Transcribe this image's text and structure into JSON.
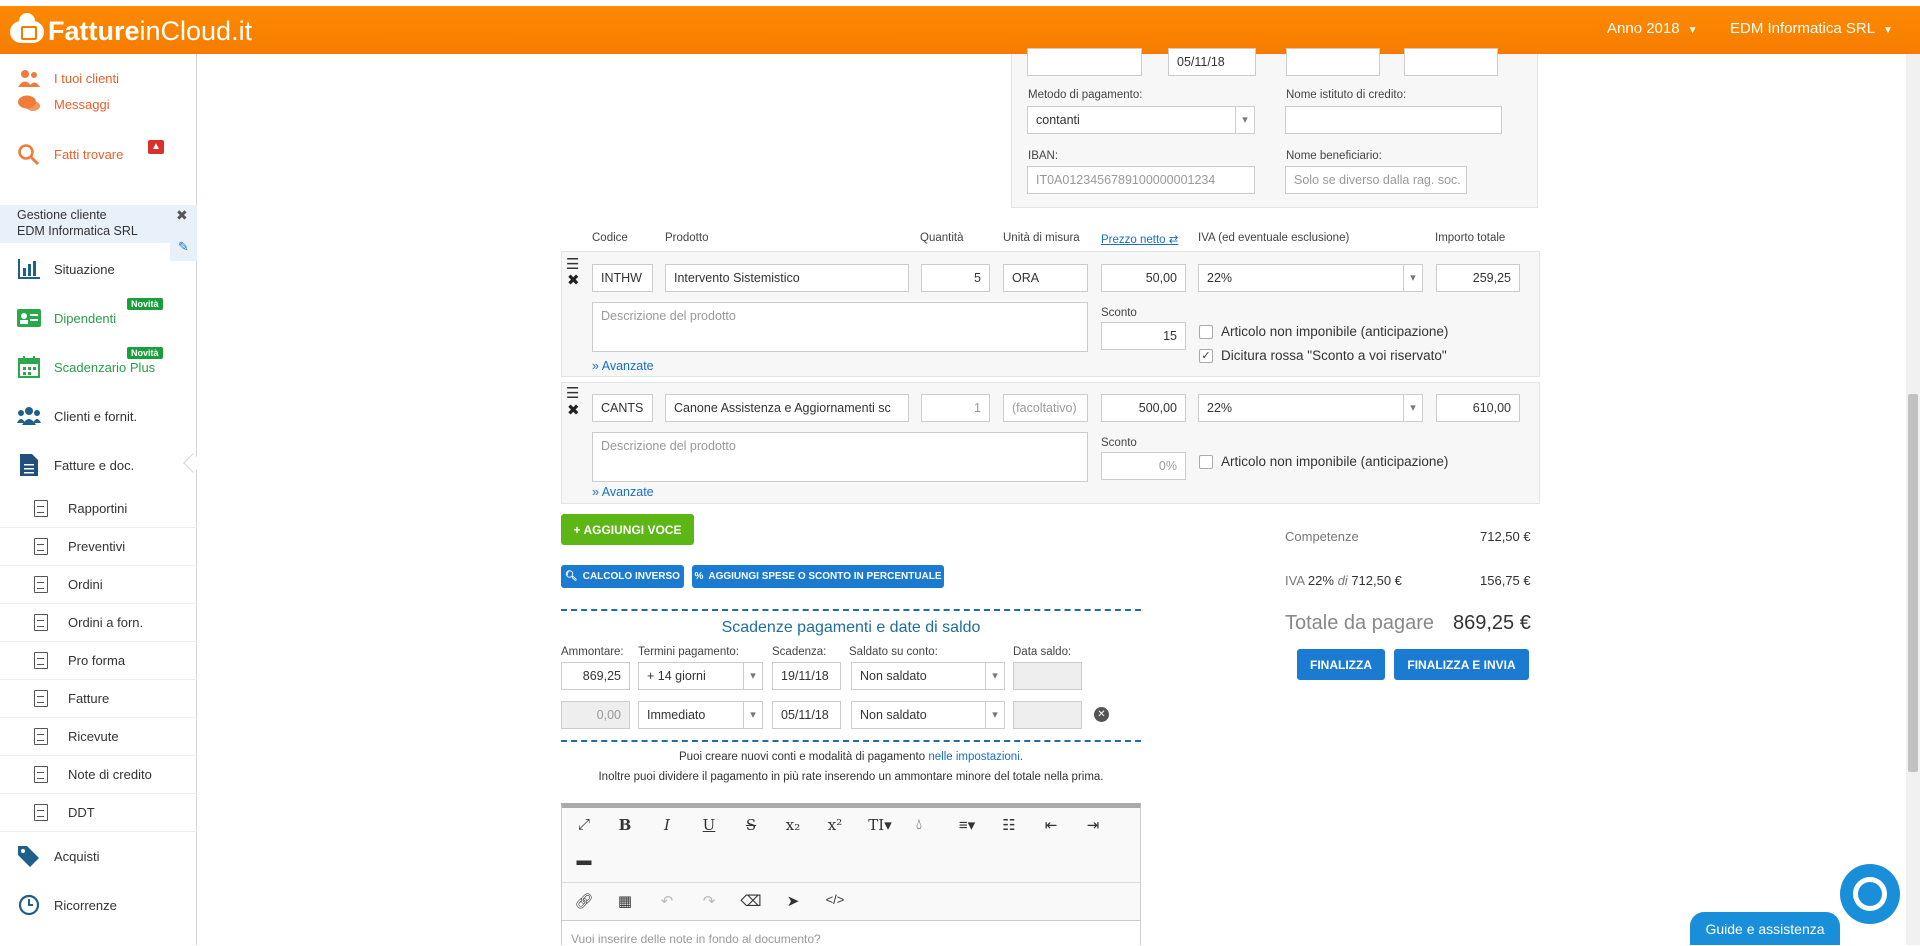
{
  "app": {
    "logo_bold": "Fatture",
    "logo_thin": "inCloud.it",
    "year_menu": "Anno 2018",
    "company_menu": "EDM Informatica SRL"
  },
  "sidebar": {
    "top_items": [
      {
        "label": "I tuoi clienti"
      },
      {
        "label": "Messaggi"
      },
      {
        "label": "Fatti trovare"
      }
    ],
    "gestione_title": "Gestione cliente",
    "gestione_client": "EDM Informatica SRL",
    "items": [
      {
        "label": "Situazione"
      },
      {
        "label": "Dipendenti",
        "badge": "Novità"
      },
      {
        "label": "Scadenzario Plus",
        "badge": "Novità"
      },
      {
        "label": "Clienti e fornit."
      },
      {
        "label": "Fatture e doc."
      }
    ],
    "sub_items": [
      "Rapportini",
      "Preventivi",
      "Ordini",
      "Ordini a forn.",
      "Pro forma",
      "Fatture",
      "Ricevute",
      "Note di credito",
      "DDT"
    ],
    "bottom_items": [
      {
        "label": "Acquisti"
      },
      {
        "label": "Ricorrenze"
      }
    ]
  },
  "payment": {
    "date_value": "05/11/18",
    "method_label": "Metodo di pagamento:",
    "method_value": "contanti",
    "bank_label": "Nome istituto di credito:",
    "iban_label": "IBAN:",
    "iban_placeholder": "IT0A0123456789100000001234",
    "beneficiary_label": "Nome beneficiario:",
    "beneficiary_placeholder": "Solo se diverso dalla rag. soc."
  },
  "table": {
    "headers": {
      "code": "Codice",
      "product": "Prodotto",
      "qty": "Quantità",
      "unit": "Unità di misura",
      "price": "Prezzo netto",
      "vat": "IVA (ed eventuale esclusione)",
      "total": "Importo totale"
    },
    "rows": [
      {
        "code": "INTHW",
        "product": "Intervento Sistemistico",
        "qty": "5",
        "unit": "ORA",
        "price": "50,00",
        "vat": "22%",
        "total": "259,25",
        "desc_placeholder": "Descrizione del prodotto",
        "discount_label": "Sconto",
        "discount": "15",
        "check1": "Articolo non imponibile (anticipazione)",
        "check2": "Dicitura rossa \"Sconto a voi riservato\"",
        "advanced": "» Avanzate"
      },
      {
        "code": "CANTS",
        "product": "Canone Assistenza e Aggiornamenti sc",
        "qty": "1",
        "unit": "(facoltativo)",
        "price": "500,00",
        "vat": "22%",
        "total": "610,00",
        "desc_placeholder": "Descrizione del prodotto",
        "discount_label": "Sconto",
        "discount": "0%",
        "check1": "Articolo non imponibile (anticipazione)",
        "advanced": "» Avanzate"
      }
    ]
  },
  "buttons": {
    "add_item": "+ AGGIUNGI VOCE",
    "reverse_calc": "CALCOLO INVERSO",
    "add_expenses": "AGGIUNGI SPESE O SCONTO IN PERCENTUALE",
    "finalize": "FINALIZZA",
    "finalize_send": "FINALIZZA E INVIA"
  },
  "totals": {
    "competenze_label": "Competenze",
    "competenze_value": "712,50 €",
    "iva_label": "IVA",
    "iva_rate": "22%",
    "iva_of": "di",
    "iva_base": "712,50 €",
    "iva_value": "156,75 €",
    "total_label": "Totale da pagare",
    "total_value": "869,25 €"
  },
  "schedule": {
    "title": "Scadenze pagamenti e date di saldo",
    "headers": {
      "amount": "Ammontare:",
      "terms": "Termini pagamento:",
      "due": "Scadenza:",
      "account": "Saldato su conto:",
      "paid_date": "Data saldo:"
    },
    "rows": [
      {
        "amount": "869,25",
        "terms": "+ 14 giorni",
        "due": "19/11/18",
        "account": "Non saldato"
      },
      {
        "amount": "0,00",
        "terms": "Immediato",
        "due": "05/11/18",
        "account": "Non saldato"
      }
    ],
    "note1_prefix": "Puoi creare nuovi conti e modalità di pagamento ",
    "note1_link": "nelle impostazioni",
    "note1_suffix": ".",
    "note2": "Inoltre puoi dividere il pagamento in più rate inserendo un ammontare minore del totale nella prima."
  },
  "editor": {
    "placeholder": "Vuoi inserire delle note in fondo al documento?"
  },
  "help": {
    "label": "Guide e assistenza"
  },
  "colors": {
    "brand": "#f57c00",
    "accent": "#1a7bd0",
    "green": "#5cb615"
  }
}
